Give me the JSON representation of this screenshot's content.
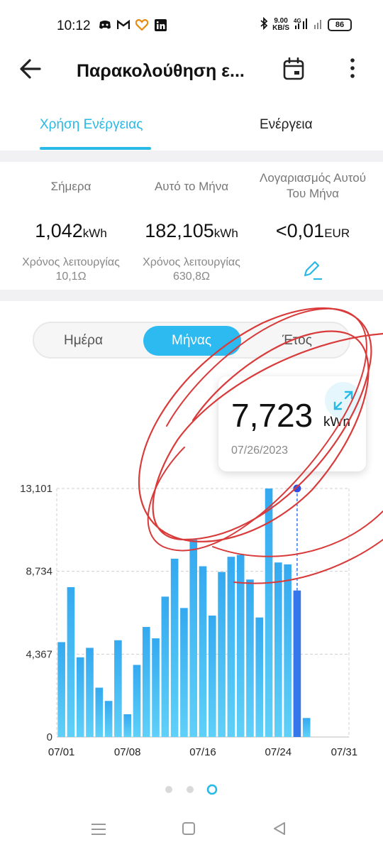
{
  "status": {
    "time": "10:12",
    "net_speed": "9.00",
    "net_unit": "KB/S",
    "network": "4G",
    "battery": "86"
  },
  "header": {
    "title": "Παρακολούθηση ε..."
  },
  "tabs": [
    {
      "label": "Χρήση Ενέργειας"
    },
    {
      "label": "Ενέργεια"
    }
  ],
  "summary": {
    "today": {
      "label": "Σήμερα",
      "value": "1,042",
      "unit": "kWh",
      "runtime": "Χρόνος λειτουργίας 10,1Ω"
    },
    "month": {
      "label": "Αυτό το Μήνα",
      "value": "182,105",
      "unit": "kWh",
      "runtime": "Χρόνος λειτουργίας 630,8Ω"
    },
    "bill": {
      "label": "Λογαριασμός Αυτού Του Μήνα",
      "value": "<0,01",
      "unit": "EUR"
    }
  },
  "period": {
    "options": [
      "Ημέρα",
      "Μήνας",
      "Έτος"
    ],
    "selected": "Μήνας"
  },
  "tooltip": {
    "value": "7,723",
    "unit": "kWh",
    "date": "07/26/2023"
  },
  "accent": "#29b9e6",
  "chart_data": {
    "type": "bar",
    "ytick_labels": [
      "0",
      "4,367",
      "8,734",
      "13,101"
    ],
    "xtick_labels": [
      "07/01",
      "07/08",
      "07/16",
      "07/24",
      "07/31"
    ],
    "ylim": [
      0,
      13.101
    ],
    "days": [
      1,
      2,
      3,
      4,
      5,
      6,
      7,
      8,
      9,
      10,
      11,
      12,
      13,
      14,
      15,
      16,
      17,
      18,
      19,
      20,
      21,
      22,
      23,
      24,
      25,
      26,
      27
    ],
    "values": [
      5.0,
      7.9,
      4.2,
      4.7,
      2.6,
      1.9,
      5.1,
      1.2,
      3.8,
      5.8,
      5.2,
      7.4,
      9.4,
      6.8,
      10.4,
      9.0,
      6.4,
      8.7,
      9.5,
      9.6,
      8.3,
      6.3,
      13.1,
      9.2,
      9.1,
      7.723,
      1.0
    ],
    "highlight_day": 26,
    "bar_color": "#3fb4ee",
    "highlight_color": "#3577ea"
  }
}
